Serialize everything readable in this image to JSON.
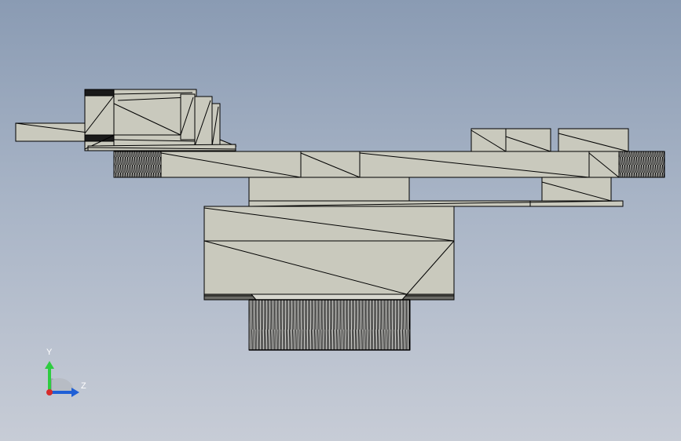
{
  "viewport": {
    "background_top": "#8a9bb3",
    "background_bottom": "#c7ccd6",
    "model_face_color": "#c9c9bd",
    "model_edge_color": "#000000"
  },
  "triad": {
    "y_label": "Y",
    "z_label": "Z",
    "y_color": "#2ecc40",
    "z_color": "#1f5fd6",
    "x_color": "#d62b2b"
  }
}
